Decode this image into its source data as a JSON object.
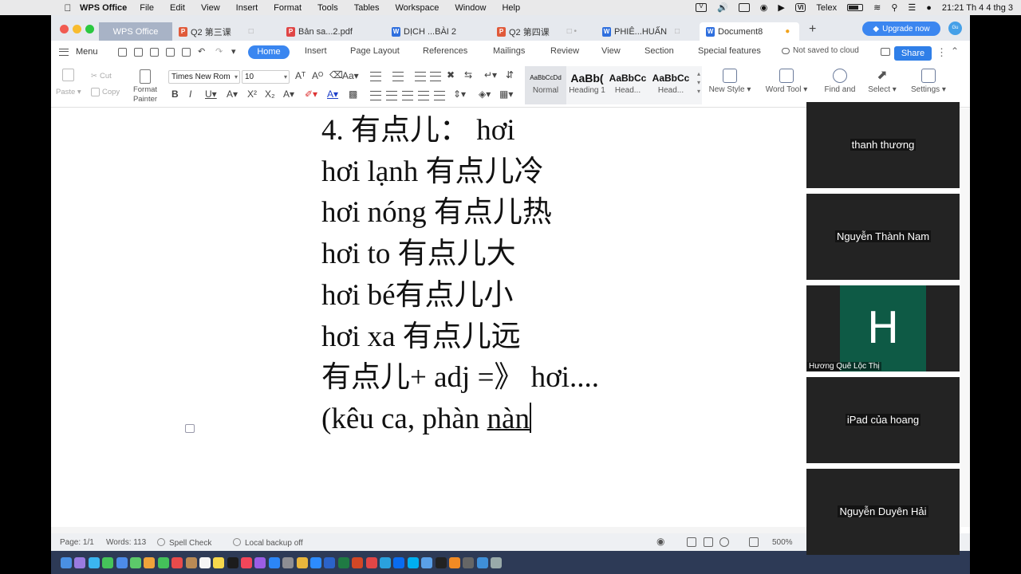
{
  "menubar": {
    "app_name": "WPS Office",
    "items": [
      "File",
      "Edit",
      "View",
      "Insert",
      "Format",
      "Tools",
      "Tables",
      "Workspace",
      "Window",
      "Help"
    ],
    "input_method": "VI",
    "input_label": "Telex",
    "clock": "21:21 Th 4 4 thg 3"
  },
  "tabs": {
    "home_tab": "WPS Office",
    "documents": [
      {
        "label": "Q2 第三课",
        "type": "p"
      },
      {
        "label": "Bản sa...2.pdf",
        "type": "f"
      },
      {
        "label": "DỊCH ...BÀI 2",
        "type": "w"
      },
      {
        "label": "Q2 第四课",
        "type": "p"
      },
      {
        "label": "PHIÊ...HUẤN",
        "type": "w"
      },
      {
        "label": "Document8",
        "type": "w"
      }
    ],
    "upgrade_label": "Upgrade now",
    "avatar_text": "Gu"
  },
  "ribbon": {
    "menu_label": "Menu",
    "tabs": [
      "Home",
      "Insert",
      "Page Layout",
      "References",
      "Mailings",
      "Review",
      "View",
      "Section",
      "Special features"
    ],
    "save_status": "Not saved to cloud",
    "share_label": "Share"
  },
  "toolbar": {
    "paste": "Paste",
    "cut": "Cut",
    "copy": "Copy",
    "format_painter_1": "Format",
    "format_painter_2": "Painter",
    "font_name": "Times New Rom",
    "font_size": "10",
    "styles": [
      {
        "preview": "AaBbCcDd",
        "name": "Normal"
      },
      {
        "preview": "AaBb(",
        "name": "Heading 1"
      },
      {
        "preview": "AaBbCc",
        "name": "Head..."
      },
      {
        "preview": "AaBbCc",
        "name": "Head..."
      }
    ],
    "new_style": "New Style",
    "word_tool": "Word Tool",
    "find_replace": "Find and",
    "select": "Select",
    "settings": "Settings"
  },
  "document": {
    "lines": [
      "4. 有点儿：  hơi",
      "hơi lạnh 有点儿冷",
      "hơi nóng 有点儿热",
      "hơi to 有点儿大",
      "hơi bé有点儿小",
      "hơi xa 有点儿远",
      "有点儿+ adj =》 hơi....",
      "(kêu ca, phàn "
    ],
    "underlined_word": "nàn"
  },
  "statusbar": {
    "page": "Page: 1/1",
    "words": "Words: 113",
    "spell_check": "Spell Check",
    "backup": "Local backup off",
    "zoom": "500%"
  },
  "participants": [
    {
      "name": "thanh thương"
    },
    {
      "name": "Nguyễn Thành Nam"
    },
    {
      "name": "Hương Quê Lộc Thị",
      "initial": "H"
    },
    {
      "name": "iPad của hoang"
    },
    {
      "name": "Nguyễn Duyên Hải"
    }
  ],
  "colors": {
    "accent": "#3a86f0",
    "tile_background": "#232323",
    "avatar_green": "#0e5a45",
    "dock": "#2d3a56"
  },
  "dock_icons": [
    "finder-icon",
    "launchpad-icon",
    "safari-icon",
    "messages-icon",
    "mail-icon",
    "maps-icon",
    "photos-icon",
    "facetime-icon",
    "calendar-icon",
    "contacts-icon",
    "reminders-icon",
    "notes-icon",
    "tv-icon",
    "music-icon",
    "podcasts-icon",
    "appstore-icon",
    "settings-icon",
    "chrome-icon",
    "zoom-icon",
    "word-icon",
    "excel-icon",
    "powerpoint-icon",
    "wps-icon",
    "telegram-icon",
    "zalo-icon",
    "skype-icon",
    "preview-icon",
    "terminal-icon",
    "vlc-icon",
    "calculator-icon",
    "folder-icon",
    "trash-icon"
  ]
}
